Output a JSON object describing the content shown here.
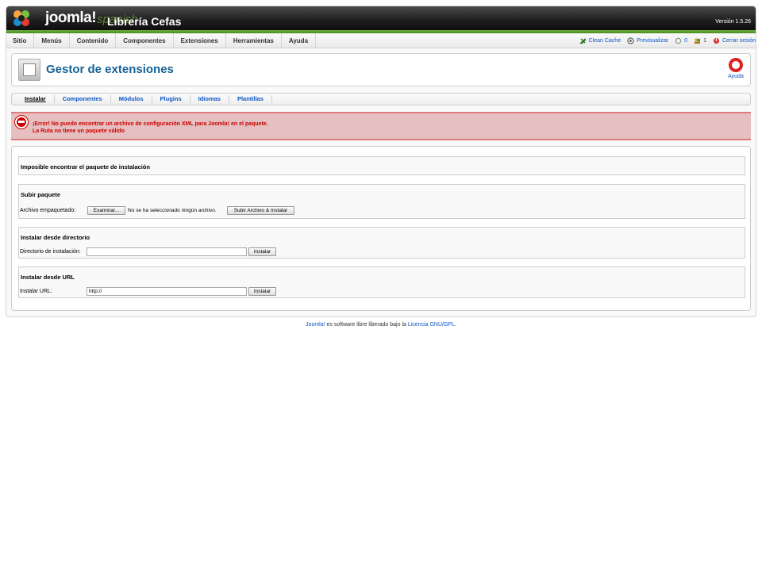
{
  "header": {
    "brand": "joomla!",
    "brand_faint": "spanish",
    "site_name": "Librería Cefas",
    "version": "Versión 1.5.26"
  },
  "menu": {
    "items": [
      "Sitio",
      "Menús",
      "Contenido",
      "Componentes",
      "Extensiones",
      "Herramientas",
      "Ayuda"
    ]
  },
  "status": {
    "clean_cache": "Clean Cache",
    "preview": "Previsualizar",
    "messages_count": "0",
    "users_count": "1",
    "logout": "Cerrar sesión"
  },
  "toolbar": {
    "title": "Gestor de extensiones",
    "help_label": "Ayuda"
  },
  "subnav": {
    "tabs": [
      "Instalar",
      "Componentes",
      "Módulos",
      "Plugins",
      "Idiomas",
      "Plantillas"
    ],
    "active": "Instalar"
  },
  "error": {
    "line1": "¡Error! No puedo encontrar un archivo de configuración XML para Joomla! en el paquete.",
    "line2": "La Ruta no tiene un paquete válido"
  },
  "install": {
    "warning_title": "Imposible encontrar el paquete de instalación",
    "upload": {
      "title": "Subir paquete",
      "label": "Archivo empaquetado:",
      "browse_button": "Examinar...",
      "no_file": "No se ha seleccionado ningún archivo.",
      "submit_button": "Subir Archivo & Instalar"
    },
    "directory": {
      "title": "Instalar desde directorio",
      "label": "Directorio de instalación:",
      "value": "",
      "button": "Instalar"
    },
    "url": {
      "title": "Instalar desde URL",
      "label": "Instalar URL:",
      "value": "http://",
      "button": "Instalar"
    }
  },
  "footer": {
    "joomla_link": "Joomla!",
    "text": " es software libre liberado bajo la ",
    "license_link": "Licencia GNU/GPL",
    "period": "."
  },
  "colors": {
    "accent_green": "#6fb03a",
    "title_blue": "#146295",
    "link_blue": "#0b55c4",
    "error_red": "#cc0000",
    "error_bg": "#e6c0c0"
  }
}
